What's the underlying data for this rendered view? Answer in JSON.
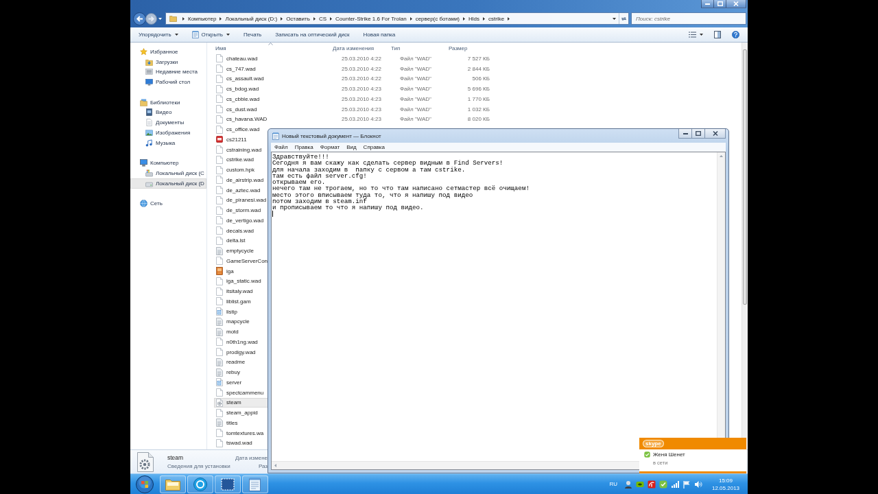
{
  "explorer": {
    "address": {
      "segments": [
        "Компьютер",
        "Локальный диск (D:)",
        "Оставить",
        "CS",
        "Counter-Strike 1.6 For Trolan",
        "сервер(с ботами)",
        "Hlds",
        "cstrike"
      ]
    },
    "search": {
      "placeholder": "Поиск: cstrike"
    },
    "toolbar": [
      {
        "label": "Упорядочить",
        "kind": "menu"
      },
      {
        "label": "Открыть",
        "kind": "app-menu"
      },
      {
        "label": "Печать",
        "kind": "command"
      },
      {
        "label": "Записать на оптический диск",
        "kind": "command"
      },
      {
        "label": "Новая папка",
        "kind": "command"
      }
    ],
    "sidebar": [
      {
        "label": "Избранное",
        "kind": "favorites",
        "selected": false,
        "children": [
          {
            "label": "Загрузки",
            "kind": "downloads",
            "selected": false
          },
          {
            "label": "Недавние места",
            "kind": "recent",
            "selected": false
          },
          {
            "label": "Рабочий стол",
            "kind": "desktop",
            "selected": false
          }
        ]
      },
      {
        "label": "Библиотеки",
        "kind": "libraries",
        "selected": false,
        "children": [
          {
            "label": "Видео",
            "kind": "video",
            "selected": false
          },
          {
            "label": "Документы",
            "kind": "documents",
            "selected": false
          },
          {
            "label": "Изображения",
            "kind": "pictures",
            "selected": false
          },
          {
            "label": "Музыка",
            "kind": "music",
            "selected": false
          }
        ]
      },
      {
        "label": "Компьютер",
        "kind": "computer",
        "selected": false,
        "children": [
          {
            "label": "Локальный диск (C",
            "kind": "system-drive",
            "selected": false
          },
          {
            "label": "Локальный диск (D",
            "kind": "drive",
            "selected": true
          }
        ]
      },
      {
        "label": "Сеть",
        "kind": "network",
        "selected": false
      }
    ],
    "columns": [
      {
        "label": "Имя",
        "sorted": true
      },
      {
        "label": "Дата изменения",
        "sorted": false
      },
      {
        "label": "Тип",
        "sorted": false
      },
      {
        "label": "Размер",
        "sorted": false
      }
    ],
    "rows": [
      {
        "name": "chateau.wad",
        "date": "25.03.2010 4:22",
        "type": "Файл \"WAD\"",
        "size": "7 527 КБ",
        "kind": "file",
        "selected": false
      },
      {
        "name": "cs_747.wad",
        "date": "25.03.2010 4:22",
        "type": "Файл \"WAD\"",
        "size": "2 844 КБ",
        "kind": "file",
        "selected": false
      },
      {
        "name": "cs_assault.wad",
        "date": "25.03.2010 4:22",
        "type": "Файл \"WAD\"",
        "size": "506 КБ",
        "kind": "file",
        "selected": false
      },
      {
        "name": "cs_bdog.wad",
        "date": "25.03.2010 4:23",
        "type": "Файл \"WAD\"",
        "size": "5 696 КБ",
        "kind": "file",
        "selected": false
      },
      {
        "name": "cs_cbble.wad",
        "date": "25.03.2010 4:23",
        "type": "Файл \"WAD\"",
        "size": "1 770 КБ",
        "kind": "file",
        "selected": false
      },
      {
        "name": "cs_dust.wad",
        "date": "25.03.2010 4:23",
        "type": "Файл \"WAD\"",
        "size": "1 032 КБ",
        "kind": "file",
        "selected": false
      },
      {
        "name": "cs_havana.WAD",
        "date": "25.03.2010 4:23",
        "type": "Файл \"WAD\"",
        "size": "8 020 КБ",
        "kind": "file",
        "selected": false
      },
      {
        "name": "cs_office.wad",
        "kind": "file",
        "selected": false
      },
      {
        "name": "cs21211",
        "kind": "program",
        "selected": false
      },
      {
        "name": "cstraining.wad",
        "kind": "file",
        "selected": false
      },
      {
        "name": "cstrike.wad",
        "kind": "file",
        "selected": false
      },
      {
        "name": "custom.hpk",
        "kind": "file",
        "selected": false
      },
      {
        "name": "de_airstrip.wad",
        "kind": "file",
        "selected": false
      },
      {
        "name": "de_aztec.wad",
        "kind": "file",
        "selected": false
      },
      {
        "name": "de_piranesi.wad",
        "kind": "file",
        "selected": false
      },
      {
        "name": "de_storm.wad",
        "kind": "file",
        "selected": false
      },
      {
        "name": "de_vertigo.wad",
        "kind": "file",
        "selected": false
      },
      {
        "name": "decals.wad",
        "kind": "file",
        "selected": false
      },
      {
        "name": "delta.lst",
        "kind": "file",
        "selected": false
      },
      {
        "name": "emptycycle",
        "kind": "text",
        "selected": false
      },
      {
        "name": "GameServerCon",
        "kind": "file",
        "selected": false
      },
      {
        "name": "iga",
        "kind": "image",
        "selected": false
      },
      {
        "name": "iga_static.wad",
        "kind": "file",
        "selected": false
      },
      {
        "name": "itsitaly.wad",
        "kind": "file",
        "selected": false
      },
      {
        "name": "liblist.gam",
        "kind": "file",
        "selected": false
      },
      {
        "name": "listip",
        "kind": "notepad",
        "selected": false
      },
      {
        "name": "mapcycle",
        "kind": "text",
        "selected": false
      },
      {
        "name": "motd",
        "kind": "text",
        "selected": false
      },
      {
        "name": "n0th1ng.wad",
        "kind": "file",
        "selected": false
      },
      {
        "name": "prodigy.wad",
        "kind": "file",
        "selected": false
      },
      {
        "name": "readme",
        "kind": "text",
        "selected": false
      },
      {
        "name": "rebuy",
        "kind": "text",
        "selected": false
      },
      {
        "name": "server",
        "kind": "notepad",
        "selected": false
      },
      {
        "name": "spectcammenu",
        "kind": "file",
        "selected": false
      },
      {
        "name": "steam",
        "kind": "settings",
        "selected": true
      },
      {
        "name": "steam_appid",
        "kind": "file",
        "selected": false
      },
      {
        "name": "titles",
        "kind": "text",
        "selected": false
      },
      {
        "name": "tomtextures.wa",
        "kind": "file",
        "selected": false
      },
      {
        "name": "tswad.wad",
        "kind": "file",
        "selected": false
      }
    ],
    "details": {
      "name": "steam",
      "type": "Сведения для установки",
      "labels": [
        "Дата измене",
        "Раз"
      ]
    }
  },
  "notepad": {
    "title": "Новый текстовый документ — Блокнот",
    "menu": [
      "Файл",
      "Правка",
      "Формат",
      "Вид",
      "Справка"
    ],
    "editor": {
      "value": "Здравствуйте!!!\nСегодня я вам скажу как сделать сервер видным в Find Servers!\nдля начала заходим в  папку с сервом а там cstrike.\nтам есть файл server.cfg!\nоткрываем его.\nнечего там не трогаем, но то что там написано сетмастер всё очищаем!\nместо этого вписываем туда то, что я напишу под видео\nпотом заходим в steam.inf\nи прописываем то что я напишу под видео."
    }
  },
  "taskbar": {
    "language": "RU",
    "time": "15:09",
    "date": "12.05.2013"
  },
  "skype_toast": {
    "logo": "skype",
    "contact": "Женя Шенет",
    "status": "в сети"
  }
}
